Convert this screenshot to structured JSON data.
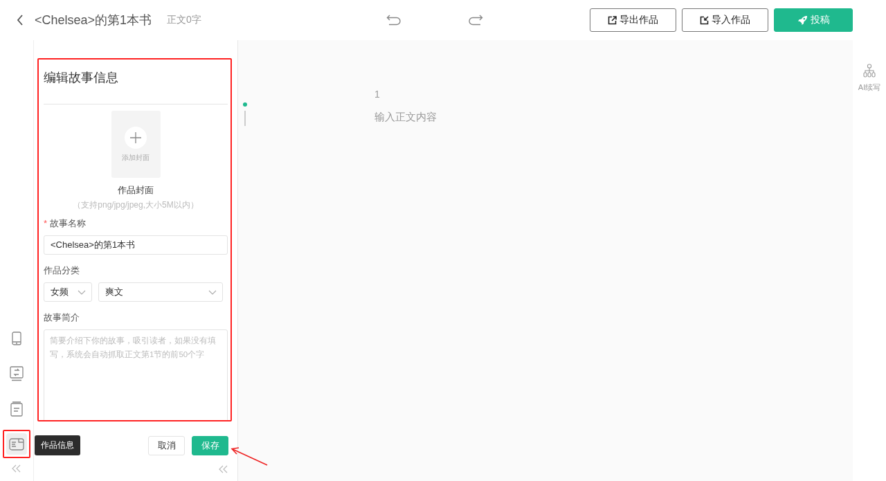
{
  "header": {
    "title": "<Chelsea>的第1本书",
    "word_count": "正文0字",
    "buttons": [
      {
        "kind": "export",
        "label": "导出作品"
      },
      {
        "kind": "import",
        "label": "导入作品"
      },
      {
        "kind": "submit",
        "label": "投稿"
      }
    ]
  },
  "sidebar": {
    "items": [
      {
        "kind": "phone",
        "selected": false
      },
      {
        "kind": "swap",
        "selected": false
      },
      {
        "kind": "document",
        "selected": false
      },
      {
        "kind": "info",
        "selected": true,
        "highlighted": true,
        "tooltip": "作品信息"
      }
    ]
  },
  "panel": {
    "highlighted": true,
    "title": "编辑故事信息",
    "cover": {
      "button": "添加封面",
      "label": "作品封面",
      "hint": "（支持png/jpg/jpeg,大小5M以内）"
    },
    "fields": [
      {
        "kind": "text",
        "required_mark": "*",
        "label": "故事名称",
        "value": "<Chelsea>的第1本书"
      },
      {
        "kind": "selects",
        "label": "作品分类",
        "values": [
          "女频",
          "爽文"
        ]
      },
      {
        "kind": "textarea",
        "label": "故事简介",
        "placeholder": "简要介绍下你的故事，吸引读者，如果没有填写，系统会自动抓取正文第1节的前50个字"
      }
    ],
    "actions": [
      {
        "kind": "cancel",
        "label": "取消"
      },
      {
        "kind": "save",
        "label": "保存",
        "pointed": true
      }
    ]
  },
  "editor": {
    "line_number": "1",
    "placeholder": "输入正文内容"
  },
  "right_rail": {
    "tools": [
      {
        "label": "AI续写"
      }
    ]
  }
}
